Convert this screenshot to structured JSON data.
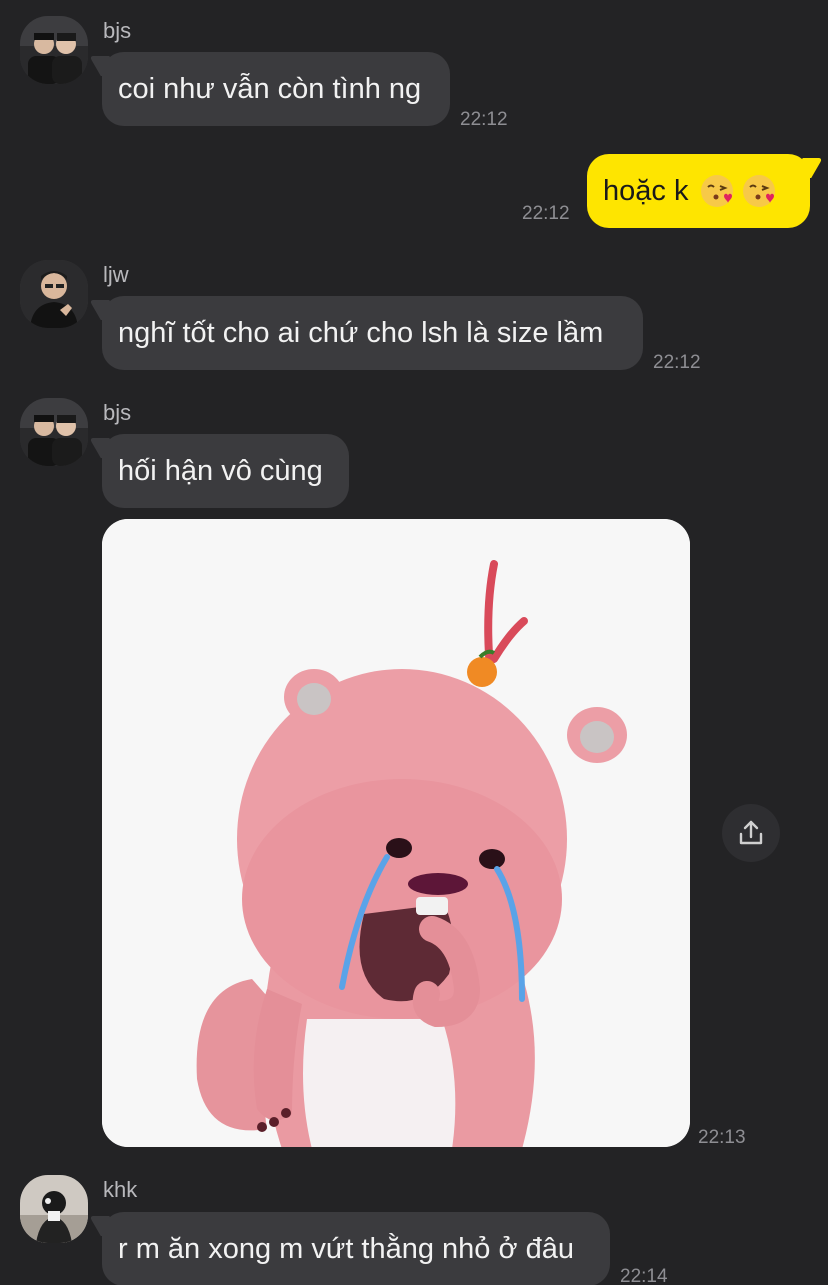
{
  "messages": [
    {
      "sender": "bjs",
      "text": "coi như vẫn còn tình ng",
      "time": "22:12"
    },
    {
      "sender": "me",
      "text": "hoặc k",
      "emoji": [
        "kissing-heart-emoji",
        "kissing-heart-emoji"
      ],
      "time": "22:12"
    },
    {
      "sender": "ljw",
      "text": "nghĩ tốt cho ai chứ cho lsh là size lầm",
      "time": "22:12"
    },
    {
      "sender": "bjs",
      "text": "hối hận vô cùng"
    },
    {
      "sender": "bjs",
      "image": "crying-pink-beaver-sticker",
      "time": "22:13"
    },
    {
      "sender": "khk",
      "text": "r m ăn xong m vứt thằng nhỏ ở đâu",
      "time": "22:14"
    }
  ],
  "colors": {
    "background": "#232325",
    "incoming_bubble": "#3b3b3e",
    "outgoing_bubble": "#fee500",
    "timestamp": "#8e8e93"
  },
  "icons": {
    "share": "share-icon"
  }
}
